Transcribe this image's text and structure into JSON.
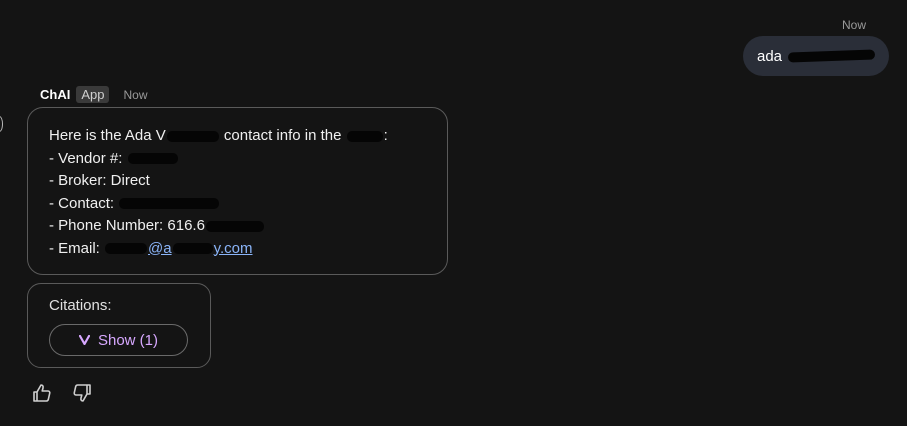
{
  "user_message": {
    "time": "Now",
    "text_prefix": "ada"
  },
  "bot": {
    "name": "ChAI",
    "badge": "App",
    "time": "Now"
  },
  "message": {
    "line1_a": "Here is the Ada V",
    "line1_b": "contact info in the",
    "line1_c": ":",
    "vendor_label": "- Vendor #:",
    "broker": "- Broker: Direct",
    "contact_label": "- Contact:",
    "phone_label": "- Phone Number: 616.6",
    "email_label": "- Email:",
    "email_visible": "@a",
    "email_tail": "y.com"
  },
  "citations": {
    "label": "Citations:",
    "button": "Show (1)"
  },
  "colors": {
    "link": "#8ab4f8",
    "citation_button": "#d7a8ff"
  }
}
